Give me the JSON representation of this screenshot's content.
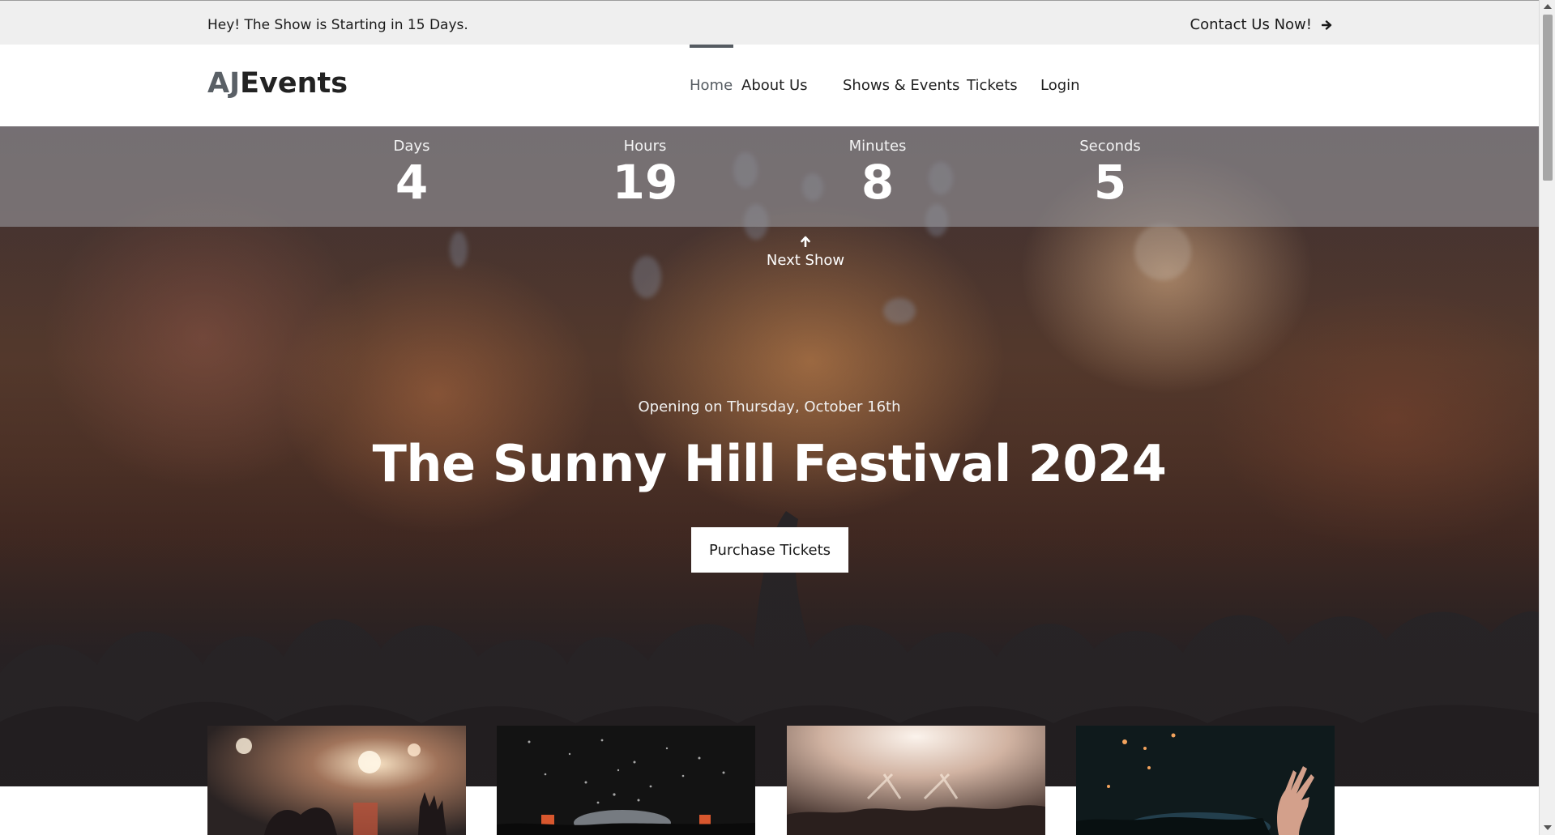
{
  "topbar": {
    "message": "Hey! The Show is Starting in 15 Days.",
    "contact_label": "Contact Us Now!",
    "contact_icon": "arrow-right-icon"
  },
  "brand": {
    "part1": "AJ",
    "part2": "Events",
    "colors": {
      "part1": "#5a6066",
      "part2": "#222222"
    }
  },
  "nav": {
    "items": [
      {
        "label": "Home",
        "active": true
      },
      {
        "label": "About Us",
        "active": false
      },
      {
        "label": "Shows & Events",
        "active": false
      },
      {
        "label": "Tickets",
        "active": false
      },
      {
        "label": "Login",
        "active": false
      }
    ]
  },
  "countdown": {
    "units": [
      {
        "label": "Days",
        "value": "4"
      },
      {
        "label": "Hours",
        "value": "19"
      },
      {
        "label": "Minutes",
        "value": "8"
      },
      {
        "label": "Seconds",
        "value": "5"
      }
    ]
  },
  "next_show": {
    "label": "Next Show",
    "icon": "arrow-up-icon"
  },
  "hero": {
    "opening": "Opening on Thursday, October 16th",
    "title": "The Sunny Hill Festival 2024",
    "cta_label": "Purchase Tickets"
  },
  "gallery": {
    "images": [
      "concert-heart-hands-photo",
      "confetti-stage-photo",
      "stage-lights-crowd-photo",
      "raised-hand-crowd-photo"
    ]
  },
  "colors": {
    "accent": "#555b61",
    "topbar_bg": "#efefef",
    "button_bg": "#ffffff"
  }
}
